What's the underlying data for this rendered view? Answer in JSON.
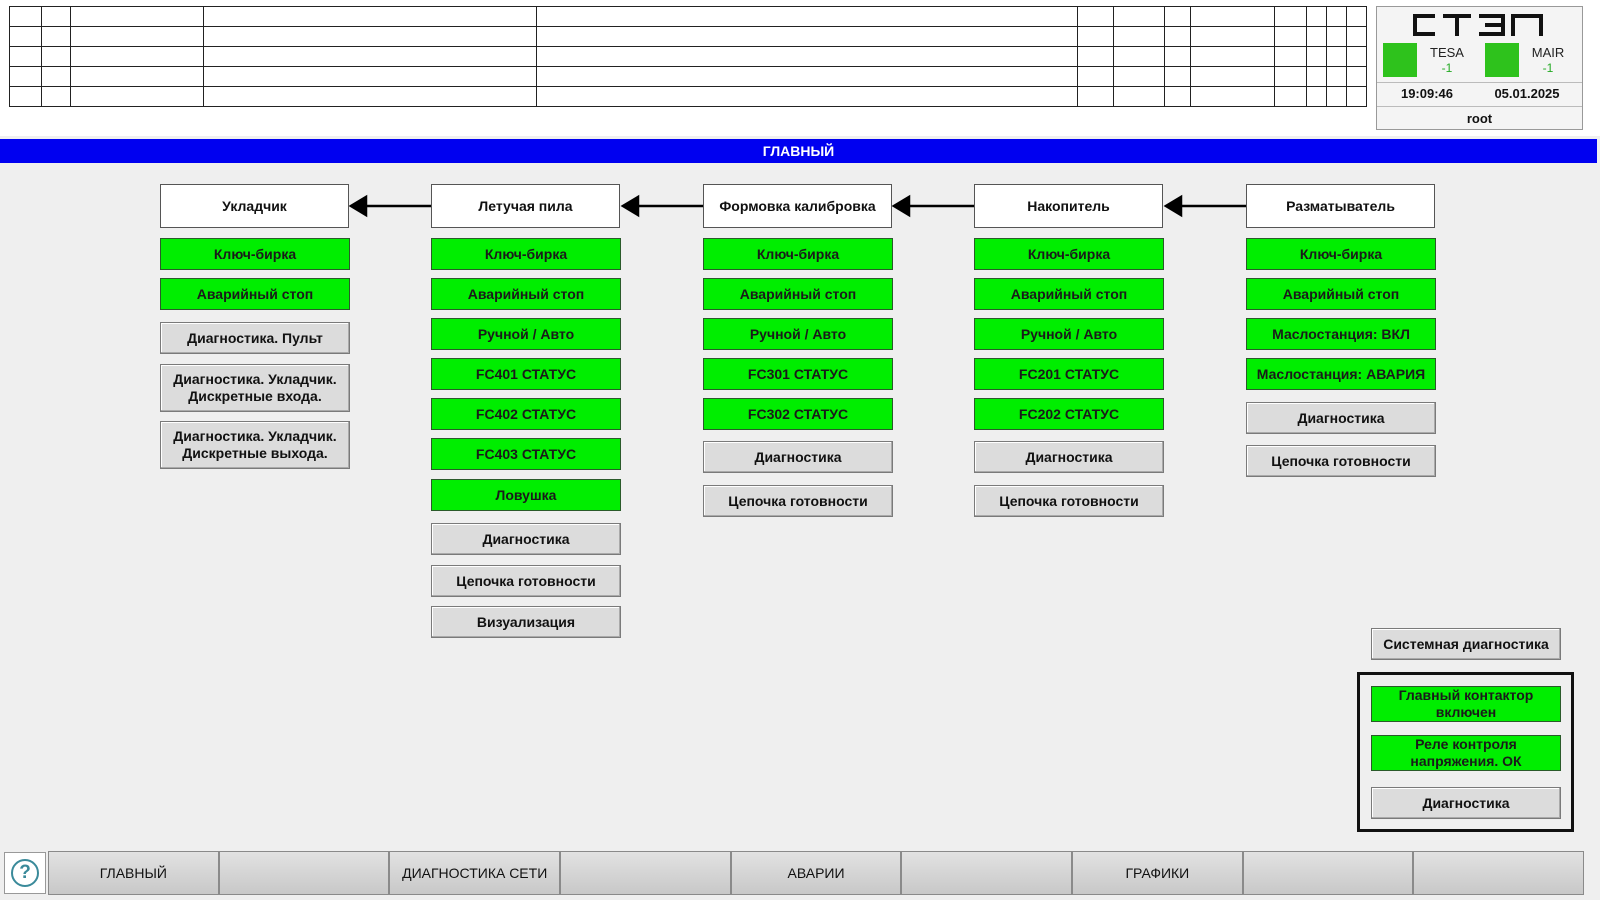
{
  "status_panel": {
    "logo_text": "СТЭП",
    "indicators": [
      {
        "name": "TESA",
        "value": "-1",
        "color": "#2ec21c"
      },
      {
        "name": "MAIR",
        "value": "-1",
        "color": "#2ec21c"
      }
    ],
    "time": "19:09:46",
    "date": "05.01.2025",
    "user": "root"
  },
  "screen_title": "ГЛАВНЫЙ",
  "columns": [
    {
      "title": "Укладчик",
      "items": [
        {
          "label": "Ключ-бирка",
          "kind": "status"
        },
        {
          "label": "Аварийный стоп",
          "kind": "status"
        },
        {
          "label": "Диагностика. Пульт",
          "kind": "button"
        },
        {
          "label": "Диагностика. Укладчик. Дискретные входа.",
          "kind": "button"
        },
        {
          "label": "Диагностика. Укладчик. Дискретные выхода.",
          "kind": "button"
        }
      ]
    },
    {
      "title": "Летучая пила",
      "items": [
        {
          "label": "Ключ-бирка",
          "kind": "status"
        },
        {
          "label": "Аварийный стоп",
          "kind": "status"
        },
        {
          "label": "Ручной / Авто",
          "kind": "status"
        },
        {
          "label": "FC401 СТАТУС",
          "kind": "status"
        },
        {
          "label": "FC402 СТАТУС",
          "kind": "status"
        },
        {
          "label": "FC403 СТАТУС",
          "kind": "status"
        },
        {
          "label": "Ловушка",
          "kind": "status"
        },
        {
          "label": "Диагностика",
          "kind": "button"
        },
        {
          "label": "Цепочка готовности",
          "kind": "button"
        },
        {
          "label": "Визуализация",
          "kind": "button"
        }
      ]
    },
    {
      "title": "Формовка калибровка",
      "items": [
        {
          "label": "Ключ-бирка",
          "kind": "status"
        },
        {
          "label": "Аварийный стоп",
          "kind": "status"
        },
        {
          "label": "Ручной / Авто",
          "kind": "status"
        },
        {
          "label": "FC301 СТАТУС",
          "kind": "status"
        },
        {
          "label": "FC302 СТАТУС",
          "kind": "status"
        },
        {
          "label": "Диагностика",
          "kind": "button"
        },
        {
          "label": "Цепочка готовности",
          "kind": "button"
        }
      ]
    },
    {
      "title": "Накопитель",
      "items": [
        {
          "label": "Ключ-бирка",
          "kind": "status"
        },
        {
          "label": "Аварийный стоп",
          "kind": "status"
        },
        {
          "label": "Ручной / Авто",
          "kind": "status"
        },
        {
          "label": "FC201 СТАТУС",
          "kind": "status"
        },
        {
          "label": "FC202 СТАТУС",
          "kind": "status"
        },
        {
          "label": "Диагностика",
          "kind": "button"
        },
        {
          "label": "Цепочка готовности",
          "kind": "button"
        }
      ]
    },
    {
      "title": "Разматыватель",
      "items": [
        {
          "label": "Ключ-бирка",
          "kind": "status"
        },
        {
          "label": "Аварийный стоп",
          "kind": "status"
        },
        {
          "label": "Маслостанция: ВКЛ",
          "kind": "status"
        },
        {
          "label": "Маслостанция: АВАРИЯ",
          "kind": "status"
        },
        {
          "label": "Диагностика",
          "kind": "button"
        },
        {
          "label": "Цепочка готовности",
          "kind": "button"
        }
      ]
    }
  ],
  "system_diag_label": "Системная диагностика",
  "power_panel": {
    "main_contactor": "Главный контактор включен",
    "voltage_relay": "Реле контроля напряжения. ОК",
    "diag": "Диагностика"
  },
  "nav": [
    "ГЛАВНЫЙ",
    "",
    "ДИАГНОСТИКА СЕТИ",
    "",
    "АВАРИИ",
    "",
    "ГРАФИКИ",
    "",
    ""
  ],
  "help_icon_glyph": "?",
  "colors": {
    "status_green": "#00ee00",
    "button_gray": "#dcdcdc",
    "title_bar_blue": "#0000f0"
  }
}
